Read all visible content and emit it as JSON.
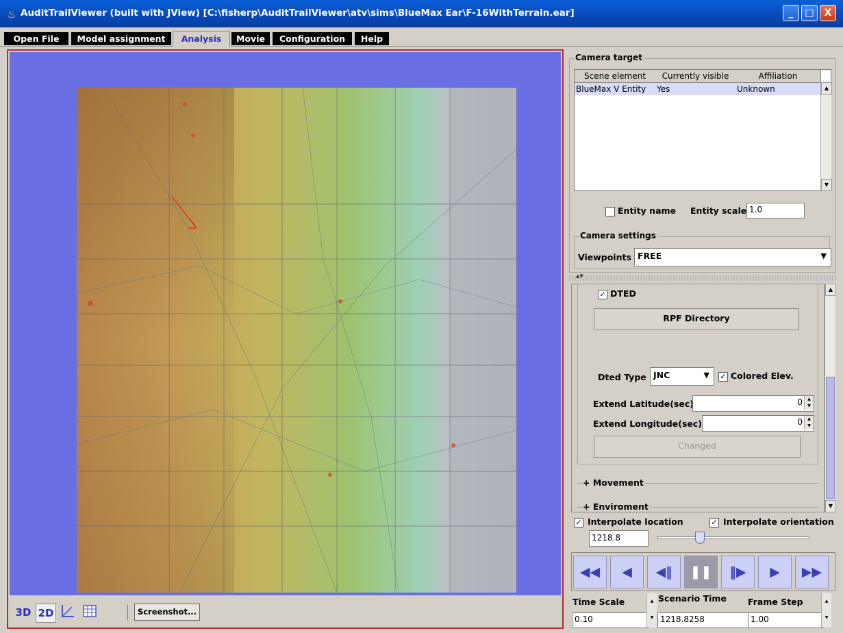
{
  "window": {
    "title": "AuditTrailViewer (built with JView)  [C:\\fisherp\\AuditTrailViewer\\atv\\sims\\BlueMax Ear\\F-16WithTerrain.ear]",
    "minimize": "_",
    "maximize": "□",
    "close": "X"
  },
  "tabs": [
    "Open File",
    "Model assignment",
    "Analysis",
    "Movie",
    "Configuration",
    "Help"
  ],
  "active_tab": "Analysis",
  "viewport": {
    "toolbar": {
      "btn_3d": "3D",
      "btn_2d": "2D",
      "screenshot": "Screenshot..."
    }
  },
  "camera_target": {
    "group_label": "Camera target",
    "columns": [
      "Scene element",
      "Currently visible",
      "Affiliation"
    ],
    "rows": [
      [
        "BlueMax V Entity",
        "Yes",
        "Unknown"
      ]
    ],
    "entity_name_label": "Entity name",
    "entity_name_checked": false,
    "entity_scale_label": "Entity scale",
    "entity_scale_value": "1.0"
  },
  "camera_settings": {
    "group_label": "Camera settings",
    "viewpoints_label": "Viewpoints",
    "viewpoints_value": "FREE"
  },
  "terrain": {
    "dted_label": "DTED",
    "dted_checked": true,
    "rpf_button": "RPF Directory",
    "dted_type_label": "Dted Type",
    "dted_type_value": "JNC",
    "colored_elev_label": "Colored Elev.",
    "colored_elev_checked": true,
    "extend_lat_label": "Extend Latitude(sec)",
    "extend_lat_value": "0",
    "extend_lon_label": "Extend Longitude(sec)",
    "extend_lon_value": "0",
    "changed_button": "Changed",
    "movement_label": "+ Movement",
    "environment_label": "+ Enviroment"
  },
  "playback": {
    "interpolate_location_label": "Interpolate location",
    "interpolate_location_checked": true,
    "interpolate_orientation_label": "Interpolate orientation",
    "interpolate_orientation_checked": true,
    "time_value": "1218.8",
    "slider_fraction": 0.26,
    "buttons": [
      "◀◀",
      "◀",
      "◀‖",
      "❚❚",
      "‖▶",
      "▶",
      "▶▶"
    ],
    "time_scale_label": "Time Scale",
    "time_scale_value": "0.10",
    "scenario_time_label": "Scenario Time",
    "scenario_time_value": "1218.8258",
    "frame_step_label": "Frame Step",
    "frame_step_value": "1.00"
  },
  "colors": {
    "title_bar": "#0848b8",
    "scene_background": "#6a6ee3",
    "viewport_border": "#b52a2a",
    "active_tab_text": "#2b2bc4"
  }
}
